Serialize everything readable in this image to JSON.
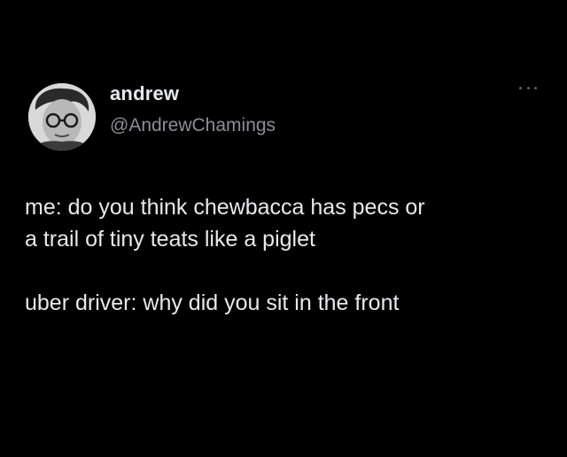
{
  "author": {
    "display_name": "andrew",
    "handle": "@AndrewChamings",
    "avatar": "profile-photo"
  },
  "tweet": {
    "line1": "me: do you think chewbacca has pecs or",
    "line2": "a trail of tiny teats like a piglet",
    "line3": "uber driver: why did you sit in the front"
  },
  "icons": {
    "more": "more-options-icon"
  },
  "colors": {
    "background": "#000000",
    "text_primary": "#e7e9ea",
    "text_secondary": "#8b8f94"
  }
}
